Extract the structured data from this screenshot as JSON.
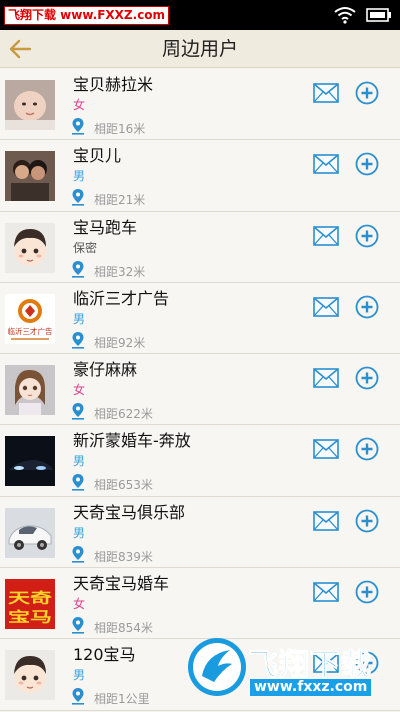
{
  "statusbar": {
    "brand": "飞翔下载 www.FXXZ.com"
  },
  "header": {
    "title": "周边用户"
  },
  "colors": {
    "female": "#e0408a",
    "male": "#3aa0dc",
    "secret": "#555555",
    "accent": "#2a8fcf"
  },
  "users": [
    {
      "name": "宝贝赫拉米",
      "gender": "女",
      "gender_type": "female",
      "distance": "相距16米",
      "avatar": "baby-photo"
    },
    {
      "name": "宝贝儿",
      "gender": "男",
      "gender_type": "male",
      "distance": "相距21米",
      "avatar": "couple-photo"
    },
    {
      "name": "宝马跑车",
      "gender": "保密",
      "gender_type": "secret",
      "distance": "相距32米",
      "avatar": "default-boy-avatar"
    },
    {
      "name": "临沂三才广告",
      "gender": "男",
      "gender_type": "male",
      "distance": "相距92米",
      "avatar": "ad-company-logo",
      "avatar_text": "临沂三才广告"
    },
    {
      "name": "豪仔麻麻",
      "gender": "女",
      "gender_type": "female",
      "distance": "相距622米",
      "avatar": "doll-photo"
    },
    {
      "name": "新沂蒙婚车-奔放",
      "gender": "男",
      "gender_type": "male",
      "distance": "相距653米",
      "avatar": "night-car-photo"
    },
    {
      "name": "天奇宝马俱乐部",
      "gender": "男",
      "gender_type": "male",
      "distance": "相距839米",
      "avatar": "white-car-photo"
    },
    {
      "name": "天奇宝马婚车",
      "gender": "女",
      "gender_type": "female",
      "distance": "相距854米",
      "avatar": "tianqi-logo",
      "avatar_text": "天奇宝马"
    },
    {
      "name": "120宝马",
      "gender": "男",
      "gender_type": "male",
      "distance": "相距1公里",
      "avatar": "default-boy-avatar"
    }
  ],
  "watermark": {
    "text": "飞翔下载",
    "url": "www.fxxz.com"
  }
}
